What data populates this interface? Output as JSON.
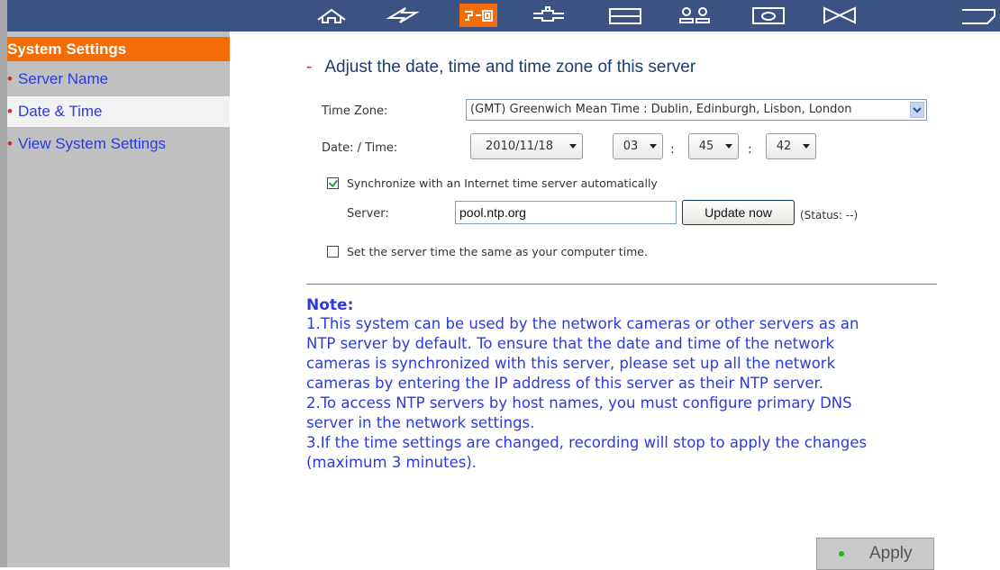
{
  "topnav": {
    "items": [
      {
        "icon": "home-icon",
        "active": false
      },
      {
        "icon": "lightning-icon",
        "active": false
      },
      {
        "icon": "system-settings-icon",
        "active": true
      },
      {
        "icon": "network-icon",
        "active": false
      },
      {
        "icon": "panel-icon",
        "active": false
      },
      {
        "icon": "users-icon",
        "active": false
      },
      {
        "icon": "monitor-icon",
        "active": false
      },
      {
        "icon": "bowtie-icon",
        "active": false
      },
      {
        "icon": "tab-icon",
        "active": false
      }
    ],
    "accent": "#f46c08",
    "bar_color": "#3b5383"
  },
  "sidebar": {
    "title": "System Settings",
    "items": [
      {
        "label": "Server Name",
        "selected": false
      },
      {
        "label": "Date & Time",
        "selected": true
      },
      {
        "label": "View System Settings",
        "selected": false
      }
    ],
    "bullet": "•"
  },
  "main": {
    "heading_dash": "-",
    "heading": "Adjust the date, time and time zone of this server",
    "timezone": {
      "label": "Time Zone:",
      "value": "(GMT) Greenwich Mean Time : Dublin, Edinburgh, Lisbon, London"
    },
    "datetime": {
      "label": "Date: / Time:",
      "date": "2010/11/18",
      "hour": "03",
      "minute": "45",
      "second": "42",
      "separator": ":"
    },
    "sync": {
      "checked": true,
      "label": "Synchronize with an Internet time server automatically",
      "server_label": "Server:",
      "server_value": "pool.ntp.org",
      "update_button": "Update now",
      "status": "(Status: --)"
    },
    "same_time": {
      "checked": false,
      "label": "Set the server time the same as your computer time."
    },
    "note": {
      "title": "Note:",
      "lines": [
        "1.This system can be used by the network cameras or other servers as an",
        "NTP server by default. To ensure that the date and time of the network",
        "cameras is synchronized with this server, please set up all the network",
        "cameras by entering the IP address of this server as their NTP server.",
        "2.To access NTP servers by host names, you must configure primary DNS",
        "server in the network settings.",
        "3.If the time settings are changed, recording will stop to apply the changes",
        "(maximum 3 minutes)."
      ]
    },
    "apply_button": "Apply"
  }
}
